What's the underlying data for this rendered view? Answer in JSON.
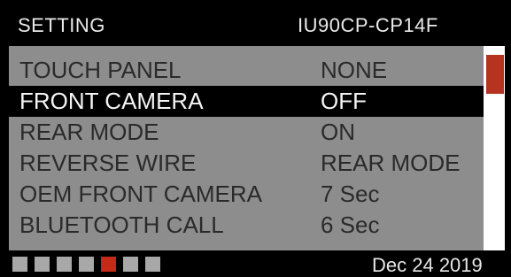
{
  "header": {
    "title": "SETTING",
    "model": "IU90CP-CP14F"
  },
  "settings": [
    {
      "label": "TOUCH PANEL",
      "value": "NONE",
      "selected": false
    },
    {
      "label": "FRONT CAMERA",
      "value": "OFF",
      "selected": true
    },
    {
      "label": "REAR MODE",
      "value": "ON",
      "selected": false
    },
    {
      "label": "REVERSE WIRE",
      "value": "REAR MODE",
      "selected": false
    },
    {
      "label": "OEM FRONT CAMERA",
      "value": "7 Sec",
      "selected": false
    },
    {
      "label": "BLUETOOTH CALL",
      "value": "6 Sec",
      "selected": false
    }
  ],
  "pager": {
    "total_pages": 7,
    "current_page": 5,
    "active_color": "#c62a17",
    "inactive_color": "#a8a8a8"
  },
  "scrollbar": {
    "position_fraction": 0.0,
    "thumb_color": "#b5331f"
  },
  "footer": {
    "date": "Dec 24 2019"
  }
}
